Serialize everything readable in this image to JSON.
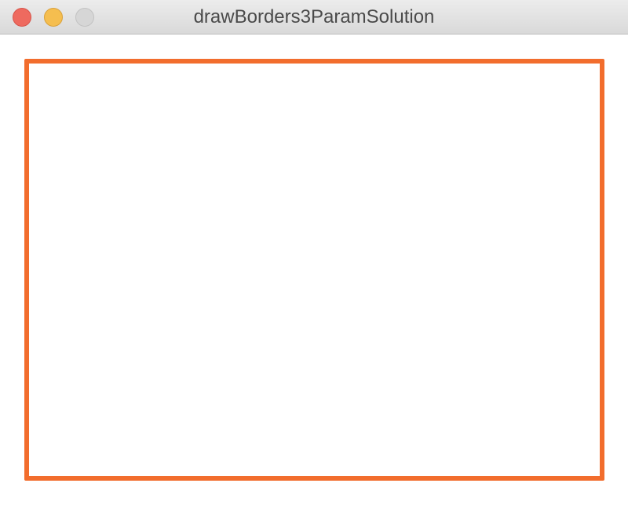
{
  "window": {
    "title": "drawBorders3ParamSolution"
  },
  "controls": {
    "close_icon": "close-icon",
    "minimize_icon": "minimize-icon",
    "zoom_icon": "zoom-icon"
  },
  "canvas": {
    "border_color": "#f26d2d",
    "background_color": "#ffffff"
  }
}
